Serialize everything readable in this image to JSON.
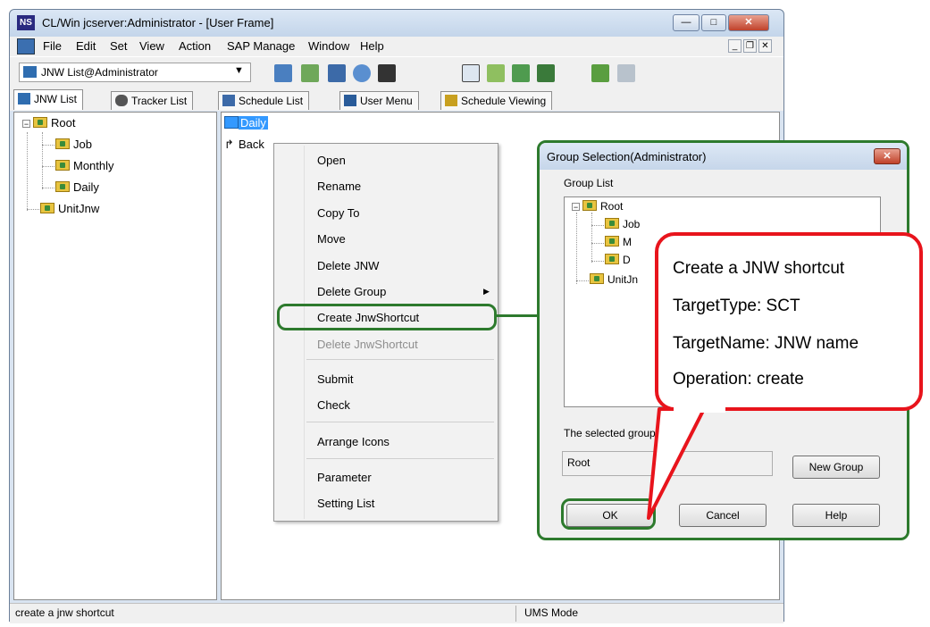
{
  "window": {
    "title": "CL/Win jcserver:Administrator - [User Frame]",
    "app_logo": "NS"
  },
  "menubar": {
    "items": [
      "File",
      "Edit",
      "Set",
      "View",
      "Action",
      "SAP Manage",
      "Window",
      "Help"
    ]
  },
  "toolbar": {
    "combo_value": "JNW List@Administrator"
  },
  "tabs": [
    {
      "label": "JNW List"
    },
    {
      "label": "Tracker List"
    },
    {
      "label": "Schedule List"
    },
    {
      "label": "User Menu"
    },
    {
      "label": "Schedule Viewing"
    }
  ],
  "left_tree": {
    "root": "Root",
    "children": [
      "Job",
      "Monthly",
      "Daily"
    ],
    "sibling": "UnitJnw"
  },
  "right_list": {
    "items": [
      "Daily",
      "Back"
    ]
  },
  "context_menu": {
    "items": [
      {
        "label": "Open"
      },
      {
        "label": "Rename"
      },
      {
        "label": "Copy To"
      },
      {
        "label": "Move"
      },
      {
        "label": "Delete JNW"
      },
      {
        "label": "Delete Group",
        "submenu_arrow": "▶"
      },
      {
        "label": "Create JnwShortcut"
      },
      {
        "label": "Delete JnwShortcut"
      },
      {
        "label": "Submit"
      },
      {
        "label": "Check"
      },
      {
        "label": "Arrange Icons"
      },
      {
        "label": "Parameter"
      },
      {
        "label": "Setting List"
      }
    ]
  },
  "dialog": {
    "title": "Group Selection(Administrator)",
    "group_list_label": "Group List",
    "tree": {
      "root": "Root",
      "children": [
        "Job",
        "M",
        "D"
      ],
      "sibling": "UnitJn"
    },
    "selected_label": "The selected group fu",
    "selected_value": "Root",
    "new_group_button": "New Group",
    "ok_button": "OK",
    "cancel_button": "Cancel",
    "help_button": "Help"
  },
  "callout": {
    "lines": [
      "Create a JNW shortcut",
      "TargetType: SCT",
      "TargetName: JNW name",
      "Operation: create"
    ]
  },
  "statusbar": {
    "message": "create a jnw shortcut",
    "mode": "UMS Mode"
  },
  "colors": {
    "highlight_green": "#2d7a2d",
    "callout_red": "#e8141c",
    "selection_blue": "#3399ff"
  }
}
